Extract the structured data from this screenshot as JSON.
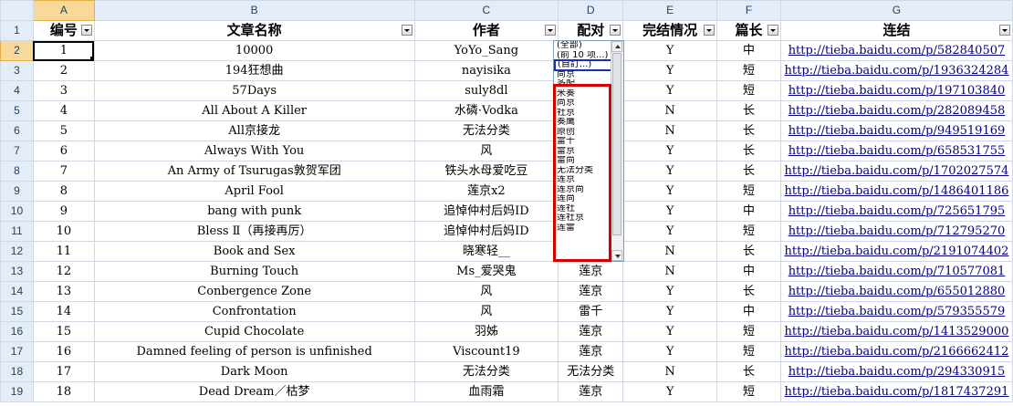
{
  "col_letters": [
    "A",
    "B",
    "C",
    "D",
    "E",
    "F",
    "G"
  ],
  "headers": [
    "编号",
    "文章名称",
    "作者",
    "配对",
    "完结情况",
    "篇长",
    "连结"
  ],
  "rows": [
    {
      "r": "2",
      "c": [
        "1",
        "10000",
        "YoYo_Sang",
        "",
        "Y",
        "中",
        "http://tieba.baidu.com/p/582840507"
      ]
    },
    {
      "r": "3",
      "c": [
        "2",
        "194狂想曲",
        "nayisika",
        "",
        "Y",
        "短",
        "http://tieba.baidu.com/p/1936324284"
      ]
    },
    {
      "r": "4",
      "c": [
        "3",
        "57Days",
        "suly8dl",
        "",
        "Y",
        "短",
        "http://tieba.baidu.com/p/197103840"
      ]
    },
    {
      "r": "5",
      "c": [
        "4",
        "All About A Killer",
        "水磷·Vodka",
        "",
        "N",
        "长",
        "http://tieba.baidu.com/p/282089458"
      ]
    },
    {
      "r": "6",
      "c": [
        "5",
        "All京接龙",
        "无法分类",
        "",
        "N",
        "长",
        "http://tieba.baidu.com/p/949519169"
      ]
    },
    {
      "r": "7",
      "c": [
        "6",
        "Always With You",
        "风",
        "",
        "Y",
        "长",
        "http://tieba.baidu.com/p/658531755"
      ]
    },
    {
      "r": "8",
      "c": [
        "7",
        "An Army of Tsurugas敦贺军团",
        "铁头水母爱吃豆",
        "",
        "Y",
        "长",
        "http://tieba.baidu.com/p/1702027574"
      ]
    },
    {
      "r": "9",
      "c": [
        "8",
        "April Fool",
        "莲京x2",
        "",
        "Y",
        "短",
        "http://tieba.baidu.com/p/1486401186"
      ]
    },
    {
      "r": "10",
      "c": [
        "9",
        "bang with punk",
        "追悼仲村后妈ID",
        "",
        "Y",
        "中",
        "http://tieba.baidu.com/p/725651795"
      ]
    },
    {
      "r": "11",
      "c": [
        "10",
        "Bless Ⅱ（再接再厉）",
        "追悼仲村后妈ID",
        "",
        "Y",
        "短",
        "http://tieba.baidu.com/p/712795270"
      ]
    },
    {
      "r": "12",
      "c": [
        "11",
        "Book and Sex",
        "晓寒轻__",
        "",
        "N",
        "长",
        "http://tieba.baidu.com/p/2191074402"
      ]
    },
    {
      "r": "13",
      "c": [
        "12",
        "Burning Touch",
        "Ms_爱哭鬼",
        "莲京",
        "N",
        "中",
        "http://tieba.baidu.com/p/710577081"
      ]
    },
    {
      "r": "14",
      "c": [
        "13",
        "Conbergence Zone",
        "风",
        "莲京",
        "Y",
        "长",
        "http://tieba.baidu.com/p/655012880"
      ]
    },
    {
      "r": "15",
      "c": [
        "14",
        "Confrontation",
        "风",
        "雷千",
        "Y",
        "中",
        "http://tieba.baidu.com/p/579355579"
      ]
    },
    {
      "r": "16",
      "c": [
        "15",
        "Cupid Chocolate",
        "羽姊",
        "莲京",
        "Y",
        "短",
        "http://tieba.baidu.com/p/1413529000"
      ]
    },
    {
      "r": "17",
      "c": [
        "16",
        "Damned feeling of person is unfinished",
        "Viscount19",
        "莲京",
        "Y",
        "短",
        "http://tieba.baidu.com/p/2166662412"
      ]
    },
    {
      "r": "18",
      "c": [
        "17",
        "Dark Moon",
        "无法分类",
        "无法分类",
        "N",
        "长",
        "http://tieba.baidu.com/p/294330915"
      ]
    },
    {
      "r": "19",
      "c": [
        "18",
        "Dead Dream／枯梦",
        "血雨霜",
        "莲京",
        "Y",
        "短",
        "http://tieba.baidu.com/p/1817437291"
      ]
    }
  ],
  "dropdown": {
    "items": [
      "(全部)",
      "(前 10 项...)",
      "(自訂...)",
      "尚京",
      "多配",
      "米奏",
      "尚京",
      "社京",
      "奏鹰",
      "原创",
      "雷千",
      "雷京",
      "雷尚",
      "无法分类",
      "莲京",
      "莲京尚",
      "莲尚",
      "莲社",
      "莲社京",
      "莲雷"
    ],
    "highlight_index": 2,
    "highlight_color": "#1a2fb8",
    "callout_color": "#d40000"
  }
}
